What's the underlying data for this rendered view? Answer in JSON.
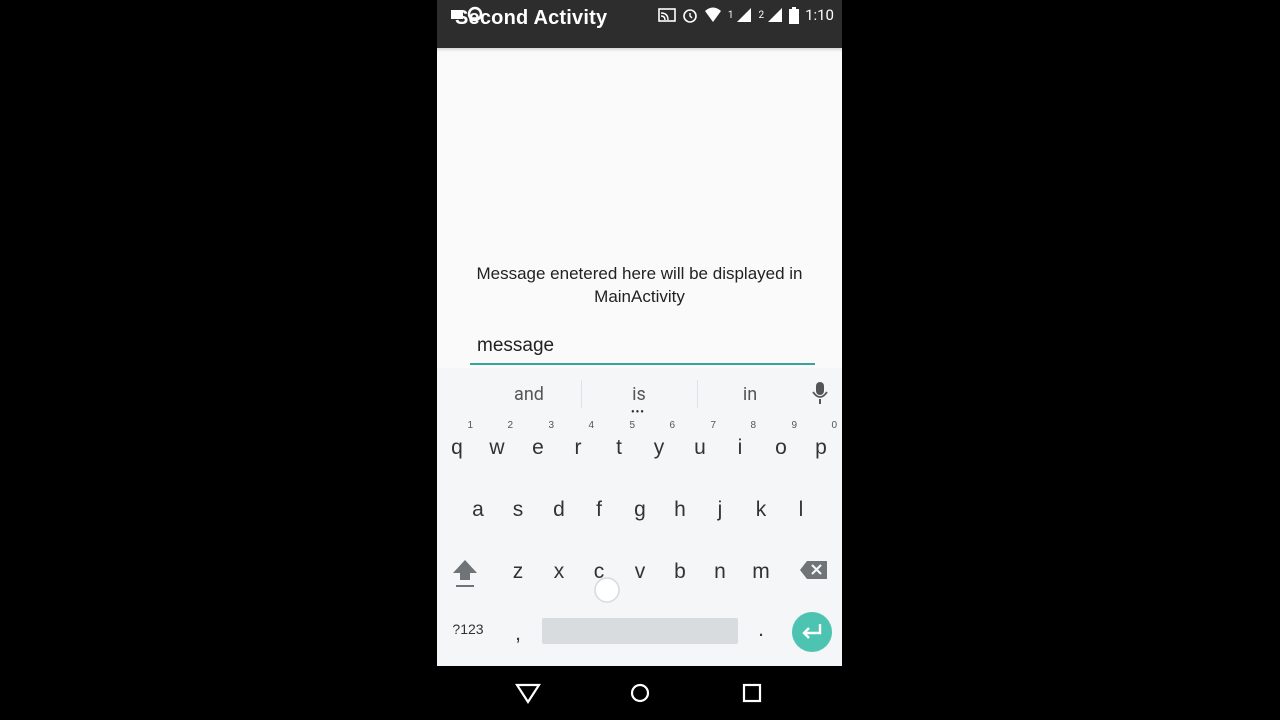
{
  "status_bar": {
    "title": "Second Activity",
    "sim1": "1",
    "sim2": "2",
    "time": "1:10"
  },
  "main": {
    "message": "Message enetered here will be displayed in MainActivity",
    "input_value": "message"
  },
  "keyboard": {
    "suggestions": [
      "and",
      "is",
      "in"
    ],
    "row1": [
      {
        "ch": "q",
        "num": "1"
      },
      {
        "ch": "w",
        "num": "2"
      },
      {
        "ch": "e",
        "num": "3"
      },
      {
        "ch": "r",
        "num": "4"
      },
      {
        "ch": "t",
        "num": "5"
      },
      {
        "ch": "y",
        "num": "6"
      },
      {
        "ch": "u",
        "num": "7"
      },
      {
        "ch": "i",
        "num": "8"
      },
      {
        "ch": "o",
        "num": "9"
      },
      {
        "ch": "p",
        "num": "0"
      }
    ],
    "row2": [
      "a",
      "s",
      "d",
      "f",
      "g",
      "h",
      "j",
      "k",
      "l"
    ],
    "row3": [
      "z",
      "x",
      "c",
      "v",
      "b",
      "n",
      "m"
    ],
    "symbols_label": "?123",
    "comma": ",",
    "period": "."
  },
  "colors": {
    "accent": "#37a59a",
    "enter_key": "#4dc3b1",
    "status_bar": "#2d2d2d"
  }
}
